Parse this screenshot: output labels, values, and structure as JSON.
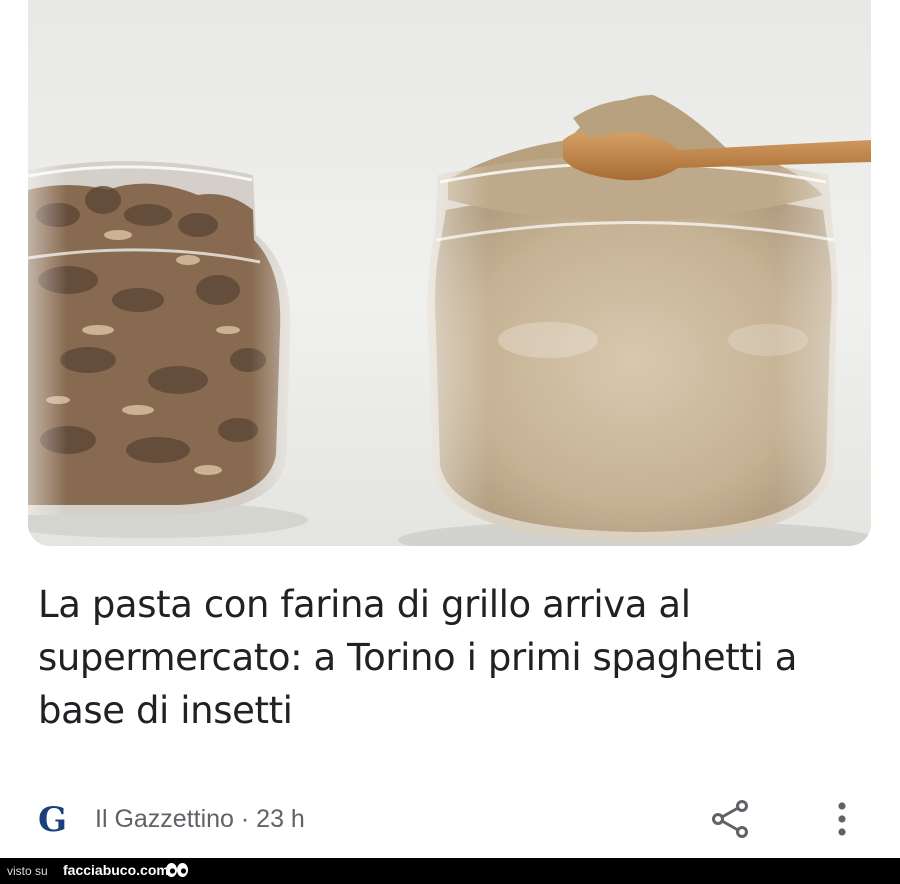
{
  "article": {
    "image_icon": "photo-of-cricket-flour-jars",
    "headline": "La pasta con farina di grillo arriva al supermercato: a Torino i primi spaghetti a base di insetti",
    "publisher_logo": "G",
    "publisher_meta": "Il Gazzettino · 23 h",
    "share_icon": "share-icon",
    "more_icon": "more-vert-icon"
  },
  "watermark": {
    "prefix": "visto su",
    "site": "facciabuco.com"
  },
  "colors": {
    "headline": "#202124",
    "meta": "#5f6368",
    "publisher": "#1a3f7a",
    "watermark_bg": "#000000"
  }
}
